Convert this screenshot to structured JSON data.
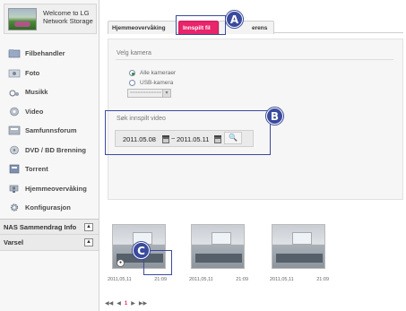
{
  "welcome": {
    "line1": "Welcome to LG",
    "line2": "Network Storage"
  },
  "menu": [
    {
      "label": "Filbehandler",
      "icon": "folder-icon"
    },
    {
      "label": "Foto",
      "icon": "photo-icon"
    },
    {
      "label": "Musikk",
      "icon": "music-icon"
    },
    {
      "label": "Video",
      "icon": "video-icon"
    },
    {
      "label": "Samfunnsforum",
      "icon": "community-icon"
    },
    {
      "label": "DVD / BD Brenning",
      "icon": "disc-icon"
    },
    {
      "label": "Torrent",
      "icon": "torrent-icon"
    },
    {
      "label": "Hjemmeovervåking",
      "icon": "camera-icon"
    },
    {
      "label": "Konfigurasjon",
      "icon": "config-icon"
    }
  ],
  "sidebar_bottom": {
    "nas_info": "NAS Sammendrag Info",
    "alert": "Varsel"
  },
  "tabs": [
    {
      "label": "Hjemmeovervåking"
    },
    {
      "label": "Innspilt fil"
    },
    {
      "label": "erens"
    }
  ],
  "callouts": {
    "a": "A",
    "b": "B",
    "c": "C"
  },
  "camera": {
    "section_label": "Velg kamera",
    "option_all": "Alle kameraer",
    "option_usb": "USB-kamera",
    "select_placeholder": "============"
  },
  "search": {
    "section_label": "Søk innspilt video",
    "date_from": "2011.05.08",
    "separator": "~",
    "date_to": "2011.05.11"
  },
  "thumbnails": [
    {
      "date": "2011,05,11",
      "time": "21:09"
    },
    {
      "date": "2011,05,11",
      "time": "21:09"
    },
    {
      "date": "2011,05,11",
      "time": "21:09"
    }
  ],
  "pager": {
    "first": "◀◀",
    "prev": "◀",
    "current": "1",
    "next": "▶",
    "last": "▶▶"
  },
  "colors": {
    "accent": "#e8246b",
    "callout": "#3a4a9c"
  }
}
